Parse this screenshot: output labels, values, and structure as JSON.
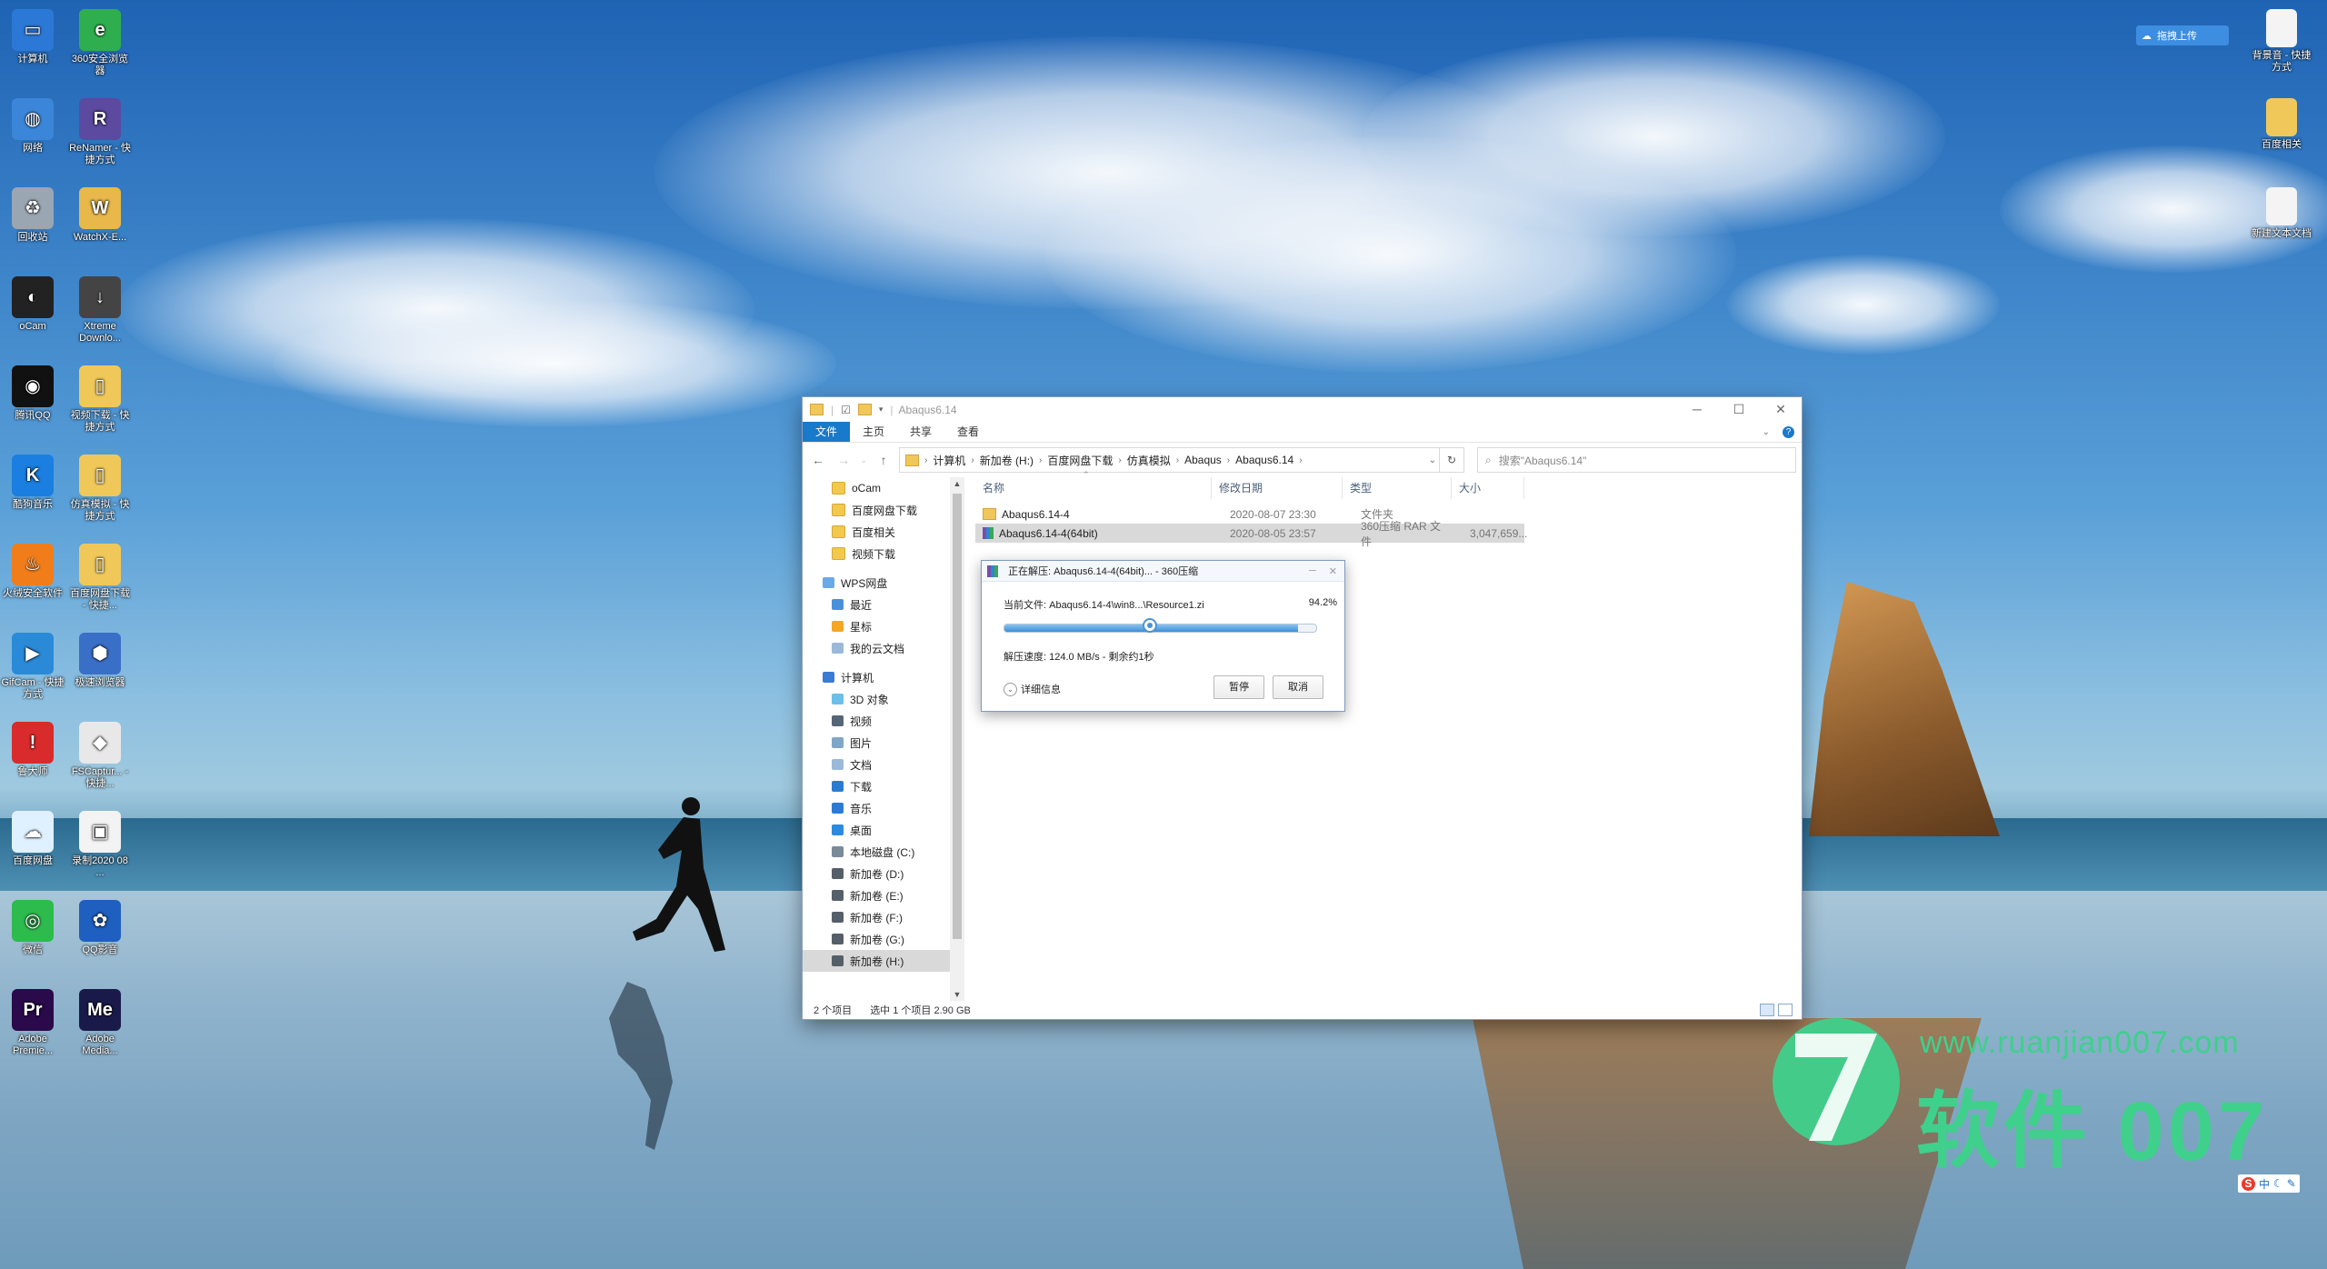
{
  "desktop_icons": [
    {
      "label": "计算机",
      "color": "#2c78d6",
      "glyph": "▭"
    },
    {
      "label": "360安全浏览器",
      "color": "#2fae4f",
      "glyph": "e"
    },
    {
      "label": "网络",
      "color": "#3b86d8",
      "glyph": "◍"
    },
    {
      "label": "ReNamer - 快捷方式",
      "color": "#5b4aa0",
      "glyph": "R"
    },
    {
      "label": "回收站",
      "color": "#9aa6b2",
      "glyph": "♻"
    },
    {
      "label": "WatchX-E...",
      "color": "#e8b84a",
      "glyph": "W"
    },
    {
      "label": "oCam",
      "color": "#222222",
      "glyph": "◐"
    },
    {
      "label": "Xtreme Downlo...",
      "color": "#444444",
      "glyph": "↓"
    },
    {
      "label": "腾讯QQ",
      "color": "#111111",
      "glyph": "◉"
    },
    {
      "label": "视频下载 - 快捷方式",
      "color": "#f0c85a",
      "glyph": "▯"
    },
    {
      "label": "酷狗音乐",
      "color": "#1a7fe0",
      "glyph": "K"
    },
    {
      "label": "仿真模拟 - 快捷方式",
      "color": "#f0c85a",
      "glyph": "▯"
    },
    {
      "label": "火绒安全软件",
      "color": "#f07d1a",
      "glyph": "♨"
    },
    {
      "label": "百度网盘下载 - 快捷...",
      "color": "#f0c85a",
      "glyph": "▯"
    },
    {
      "label": "GifCam - 快捷方式",
      "color": "#2a8ad8",
      "glyph": "▶"
    },
    {
      "label": "极速浏览器",
      "color": "#3a6fc8",
      "glyph": "⬢"
    },
    {
      "label": "鲁大师",
      "color": "#d92b2b",
      "glyph": "!"
    },
    {
      "label": "FSCaptur... - 快捷...",
      "color": "#e8e8e8",
      "glyph": "◆"
    },
    {
      "label": "百度网盘",
      "color": "#dff1ff",
      "glyph": "☁"
    },
    {
      "label": "录制2020 08 ...",
      "color": "#f3f3f3",
      "glyph": "▣"
    },
    {
      "label": "微信",
      "color": "#2dbb4e",
      "glyph": "◎"
    },
    {
      "label": "QQ影音",
      "color": "#1e5fbf",
      "glyph": "✿"
    },
    {
      "label": "Adobe Premie...",
      "color": "#2a0a4a",
      "glyph": "Pr"
    },
    {
      "label": "Adobe Media...",
      "color": "#1a1a4a",
      "glyph": "Me"
    }
  ],
  "right_icons": [
    {
      "label": "背景音 - 快捷方式"
    },
    {
      "label": "百度相关"
    },
    {
      "label": "新建文本文档"
    }
  ],
  "baidu_upload": "拖拽上传",
  "explorer": {
    "title": "Abaqus6.14",
    "ribbon_tabs": [
      "文件",
      "主页",
      "共享",
      "查看"
    ],
    "breadcrumb": [
      "计算机",
      "新加卷 (H:)",
      "百度网盘下载",
      "仿真模拟",
      "Abaqus",
      "Abaqus6.14"
    ],
    "search_placeholder": "搜索\"Abaqus6.14\"",
    "nav_items": [
      {
        "label": "oCam",
        "type": "folder"
      },
      {
        "label": "百度网盘下载",
        "type": "folder"
      },
      {
        "label": "百度相关",
        "type": "folder"
      },
      {
        "label": "视频下载",
        "type": "folder"
      },
      {
        "label": "WPS网盘",
        "type": "cloud",
        "top": true
      },
      {
        "label": "最近",
        "type": "clock"
      },
      {
        "label": "星标",
        "type": "star"
      },
      {
        "label": "我的云文档",
        "type": "doc"
      },
      {
        "label": "计算机",
        "type": "pc",
        "top": true
      },
      {
        "label": "3D 对象",
        "type": "cube"
      },
      {
        "label": "视频",
        "type": "video"
      },
      {
        "label": "图片",
        "type": "pic"
      },
      {
        "label": "文档",
        "type": "doc"
      },
      {
        "label": "下载",
        "type": "down"
      },
      {
        "label": "音乐",
        "type": "music"
      },
      {
        "label": "桌面",
        "type": "desk"
      },
      {
        "label": "本地磁盘 (C:)",
        "type": "sys"
      },
      {
        "label": "新加卷 (D:)",
        "type": "drive"
      },
      {
        "label": "新加卷 (E:)",
        "type": "drive"
      },
      {
        "label": "新加卷 (F:)",
        "type": "drive"
      },
      {
        "label": "新加卷 (G:)",
        "type": "drive"
      },
      {
        "label": "新加卷 (H:)",
        "type": "drive",
        "selected": true
      }
    ],
    "columns": [
      "名称",
      "修改日期",
      "类型",
      "大小"
    ],
    "files": [
      {
        "name": "Abaqus6.14-4",
        "date": "2020-08-07 23:30",
        "type": "文件夹",
        "size": "",
        "kind": "folder"
      },
      {
        "name": "Abaqus6.14-4(64bit)",
        "date": "2020-08-05 23:57",
        "type": "360压缩 RAR 文件",
        "size": "3,047,659...",
        "kind": "rar",
        "selected": true
      }
    ],
    "status": {
      "count": "2 个项目",
      "selected": "选中 1 个项目 2.90 GB"
    }
  },
  "extract_dialog": {
    "title": "正在解压: Abaqus6.14-4(64bit)... - 360压缩",
    "current_file": "当前文件: Abaqus6.14-4\\win8...\\Resource1.zi",
    "percent": "94.2%",
    "progress_fraction": 0.942,
    "knob_position": 0.47,
    "speed": "解压速度: 124.0 MB/s  - 剩余约1秒",
    "details": "详细信息",
    "pause": "暂停",
    "cancel": "取消"
  },
  "watermark": {
    "url": "www.ruanjian007.com",
    "name": "软件 007",
    "color": "#3fd08c"
  },
  "ime": {
    "badge": "S",
    "label": "中"
  }
}
